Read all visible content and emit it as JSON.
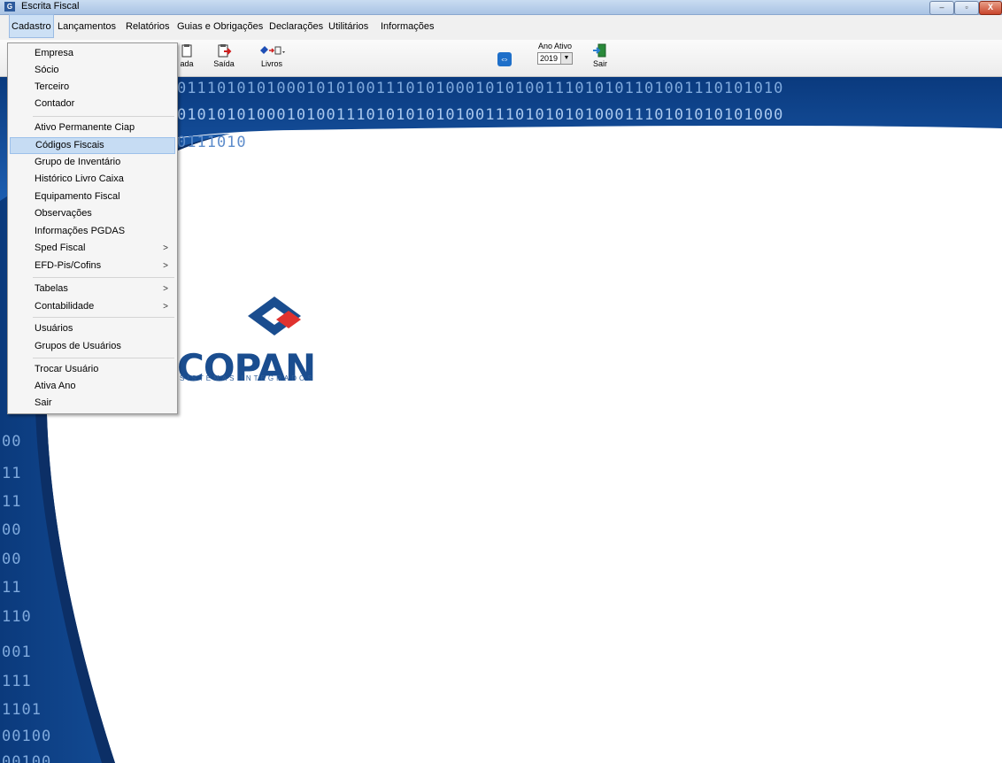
{
  "window": {
    "title": "Escrita Fiscal",
    "controls": {
      "minimize": "–",
      "maximize": "▫",
      "close": "X"
    }
  },
  "menubar": [
    "Cadastro",
    "Lançamentos",
    "Relatórios",
    "Guias e Obrigações",
    "Declarações",
    "Utilitários",
    "Informações"
  ],
  "toolbar": {
    "entrada_label": "ada",
    "saida_label": "Saída",
    "livros_label": "Livros",
    "ano_ativo_label": "Ano Ativo",
    "ano_ativo_value": "2019",
    "sair_label": "Sair"
  },
  "dropdown": {
    "items": [
      {
        "label": "Empresa"
      },
      {
        "label": "Sócio"
      },
      {
        "label": "Terceiro"
      },
      {
        "label": "Contador"
      },
      {
        "label": "Ativo Permanente  Ciap"
      },
      {
        "label": "Códigos Fiscais",
        "highlighted": true
      },
      {
        "label": "Grupo de Inventário"
      },
      {
        "label": "Histórico Livro Caixa"
      },
      {
        "label": "Equipamento Fiscal"
      },
      {
        "label": "Observações"
      },
      {
        "label": "Informações PGDAS"
      },
      {
        "label": "Sped Fiscal",
        "submenu": true
      },
      {
        "label": "EFD-Pis/Cofins",
        "submenu": true
      },
      {
        "label": "Tabelas",
        "submenu": true
      },
      {
        "label": "Contabilidade",
        "submenu": true
      },
      {
        "label": "Usuários"
      },
      {
        "label": "Grupos de Usuários"
      },
      {
        "label": "Trocar Usuário"
      },
      {
        "label": "Ativa Ano"
      },
      {
        "label": "Sair"
      }
    ],
    "submenu_glyph": ">"
  },
  "background": {
    "binary_row1": "0111010101000101010011101010001010100111010101101001110101010",
    "binary_row2": "0101010100010100111010101010100111010101010001110101010101000",
    "binary_row3": "0111010",
    "left_digits": [
      "00",
      "11",
      "11",
      "00",
      "00",
      "11",
      "110",
      "001",
      "111",
      "1101",
      "00100",
      "00100"
    ]
  },
  "logo": {
    "word": "COPAN",
    "subtitle": "SISTEMAS INTEGRADOS",
    "colors": {
      "blue": "#1a4d8f",
      "red": "#e0322f"
    }
  },
  "colors": {
    "menu_highlight": "#c6dcf3",
    "banner_blue": "#0d3f86"
  }
}
